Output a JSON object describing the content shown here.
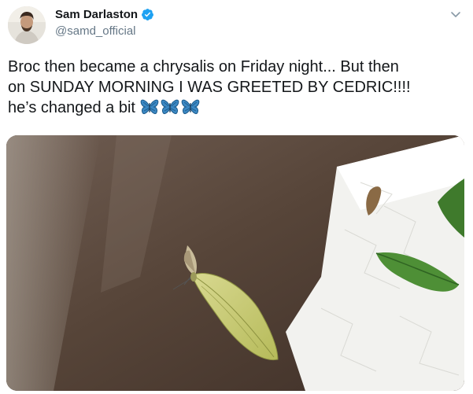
{
  "author": {
    "display_name": "Sam Darlaston",
    "handle": "@samd_official"
  },
  "tweet": {
    "text_line1": "Broc then became a chrysalis on Friday night... But then",
    "text_line2": "on SUNDAY MORNING I WAS GREETED BY CEDRIC!!!!",
    "text_line3": "he’s changed a bit",
    "emojis": [
      "butterfly-emoji",
      "butterfly-emoji",
      "butterfly-emoji"
    ]
  },
  "icons": {
    "verified": "verified-badge-icon",
    "menu": "chevron-down-icon"
  },
  "colors": {
    "text": "#14171a",
    "secondary": "#657786",
    "verified_blue": "#1da1f2",
    "emoji_blue": "#3b88c3"
  }
}
